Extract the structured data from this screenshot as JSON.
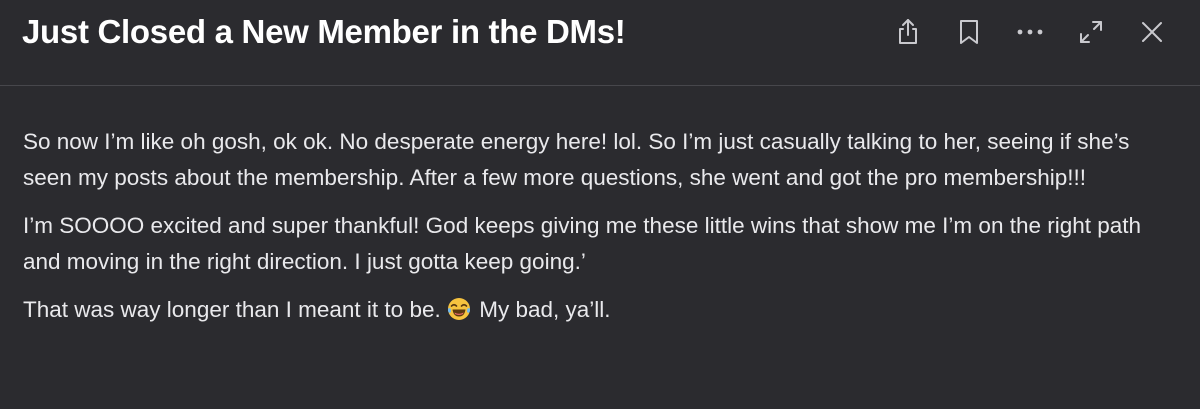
{
  "post": {
    "title": "Just Closed a New Member in the DMs!",
    "paragraphs": [
      "So now I’m like oh gosh, ok ok. No desperate energy here! lol. So I’m just casually talking to her, seeing if she’s seen my posts about the membership. After a few more questions, she went and got the pro membership!!!",
      "I’m SOOOO excited and super thankful! God keeps giving me these little wins that show me I’m on the right path and moving in the right direction. I just gotta keep going.’"
    ],
    "last_paragraph": {
      "before": "That was way longer than I meant it to be. ",
      "emoji": "laughing-crying-emoji",
      "after": " My bad, ya’ll."
    }
  },
  "toolbar": {
    "icons": [
      "share-icon",
      "bookmark-icon",
      "more-icon",
      "expand-icon",
      "close-icon"
    ]
  },
  "colors": {
    "background": "#2b2b2f",
    "title_text": "#ffffff",
    "body_text": "#e9e9ec",
    "icon": "#c9c9ce",
    "divider": "#47474c"
  }
}
